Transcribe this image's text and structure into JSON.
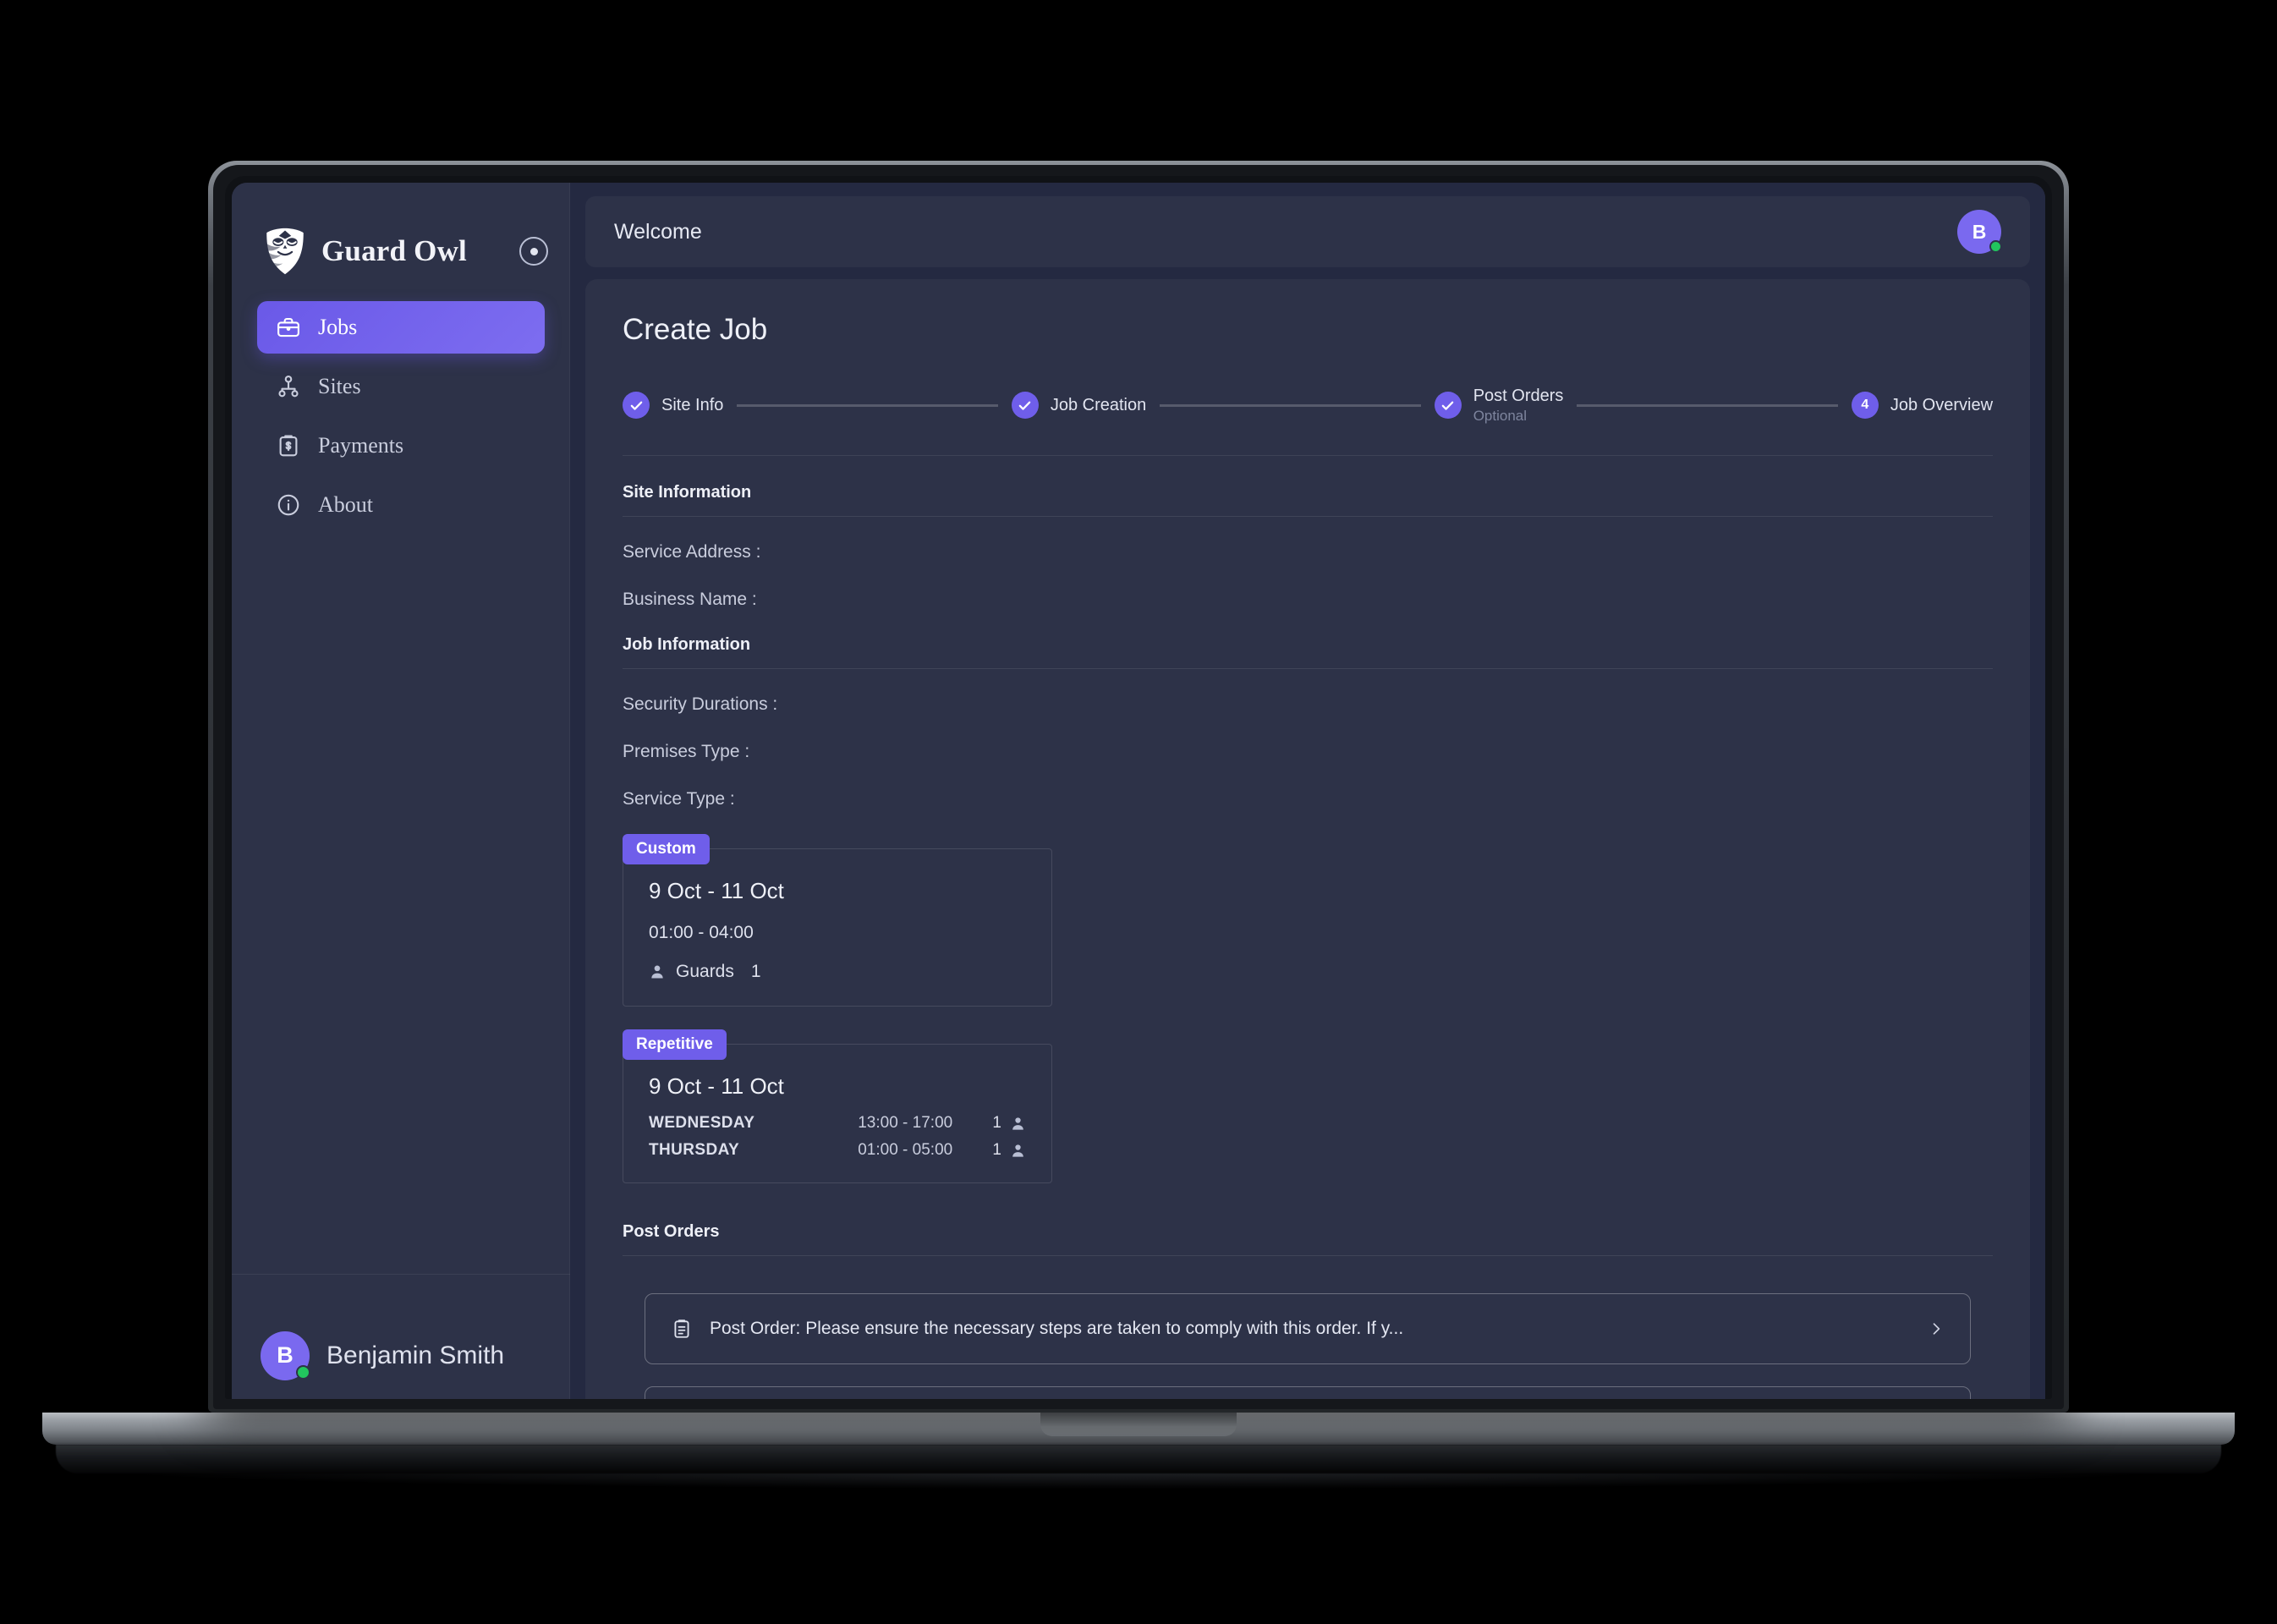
{
  "app": {
    "brand_name": "Guard Owl",
    "logo_icon": "owl-shield-icon",
    "sidebar_toggle_icon": "circle-dot-icon"
  },
  "sidebar": {
    "items": [
      {
        "label": "Jobs",
        "icon": "briefcase-icon",
        "active": true
      },
      {
        "label": "Sites",
        "icon": "sitemap-icon",
        "active": false
      },
      {
        "label": "Payments",
        "icon": "payment-clipboard-icon",
        "active": false
      },
      {
        "label": "About",
        "icon": "info-circle-icon",
        "active": false
      }
    ],
    "profile": {
      "name": "Benjamin Smith",
      "initial": "B",
      "status": "online"
    }
  },
  "topbar": {
    "welcome": "Welcome",
    "avatar_initial": "B",
    "status": "online"
  },
  "page": {
    "title": "Create Job"
  },
  "stepper": {
    "steps": [
      {
        "label": "Site Info",
        "sub": "",
        "state": "complete",
        "marker": "check"
      },
      {
        "label": "Job Creation",
        "sub": "",
        "state": "complete",
        "marker": "check"
      },
      {
        "label": "Post Orders",
        "sub": "Optional",
        "state": "complete",
        "marker": "check"
      },
      {
        "label": "Job Overview",
        "sub": "",
        "state": "current",
        "marker": "4"
      }
    ]
  },
  "site_information": {
    "heading": "Site Information",
    "fields": [
      {
        "label": "Service Address :",
        "value": ""
      },
      {
        "label": "Business Name :",
        "value": ""
      }
    ]
  },
  "job_information": {
    "heading": "Job Information",
    "fields": [
      {
        "label": "Security Durations :",
        "value": ""
      },
      {
        "label": "Premises Type :",
        "value": ""
      },
      {
        "label": "Service Type :",
        "value": ""
      }
    ]
  },
  "schedules": [
    {
      "tag": "Custom",
      "date_range": "9 Oct - 11 Oct",
      "time_range": "01:00 - 04:00",
      "guards_label": "Guards",
      "guards_count": "1",
      "guard_icon": "person-icon"
    },
    {
      "tag": "Repetitive",
      "date_range": "9 Oct - 11 Oct",
      "rows": [
        {
          "day": "WEDNESDAY",
          "time": "13:00 - 17:00",
          "count": "1",
          "guard_icon": "person-icon"
        },
        {
          "day": "THURSDAY",
          "time": "01:00 - 05:00",
          "count": "1",
          "guard_icon": "person-icon"
        }
      ]
    }
  ],
  "post_orders": {
    "heading": "Post Orders",
    "items": [
      {
        "icon": "clipboard-icon",
        "text": "Post Order: Please ensure the necessary steps are taken to comply with this order. If y...",
        "chevron": "chevron-right-icon"
      }
    ]
  },
  "colors": {
    "accent": "#6f5eea",
    "sidebar_bg": "#2d3248",
    "panel_bg": "#2d3248",
    "app_bg": "#242941",
    "online": "#22c55e",
    "text_primary": "#eef0f7",
    "text_muted": "#c9cddd"
  }
}
